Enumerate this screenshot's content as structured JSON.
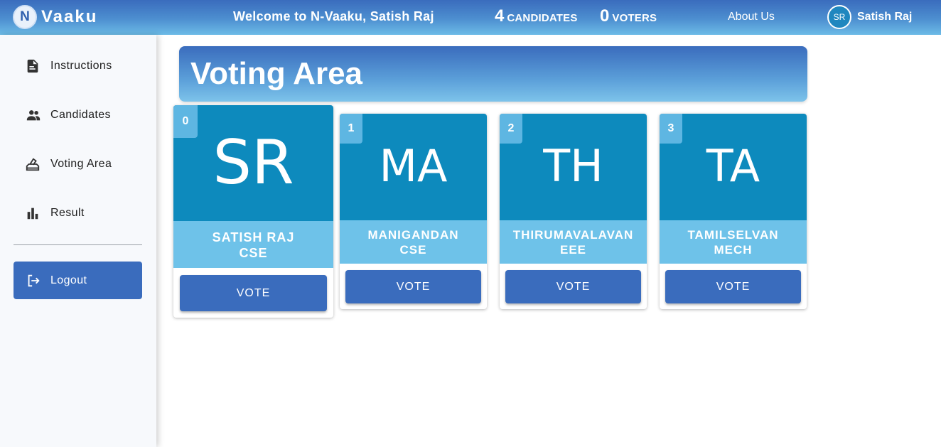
{
  "app": {
    "logo_letter": "N",
    "logo_text": "Vaaku",
    "welcome": "Welcome to N-Vaaku, Satish Raj",
    "candidates_count": "4",
    "candidates_label": "CANDIDATES",
    "voters_count": "0",
    "voters_label": "VOTERS",
    "about": "About Us",
    "user_initials": "SR",
    "user_name": "Satish Raj"
  },
  "sidebar": {
    "items": [
      {
        "label": "Instructions",
        "icon": "document-icon"
      },
      {
        "label": "Candidates",
        "icon": "people-icon"
      },
      {
        "label": "Voting Area",
        "icon": "ballot-icon"
      },
      {
        "label": "Result",
        "icon": "bar-chart-icon"
      }
    ],
    "logout": "Logout"
  },
  "main": {
    "title": "Voting Area",
    "vote_label": "VOTE",
    "candidates": [
      {
        "index": "0",
        "initials": "SR",
        "name": "SATISH RAJ",
        "dept": "CSE"
      },
      {
        "index": "1",
        "initials": "MA",
        "name": "MANIGANDAN",
        "dept": "CSE"
      },
      {
        "index": "2",
        "initials": "TH",
        "name": "THIRUMAVALAVAN",
        "dept": "EEE"
      },
      {
        "index": "3",
        "initials": "TA",
        "name": "TAMILSELVAN",
        "dept": "MECH"
      }
    ]
  },
  "colors": {
    "primary": "#3a6cbd",
    "card_top": "#0d8abd",
    "card_band": "#6ec2e9"
  }
}
